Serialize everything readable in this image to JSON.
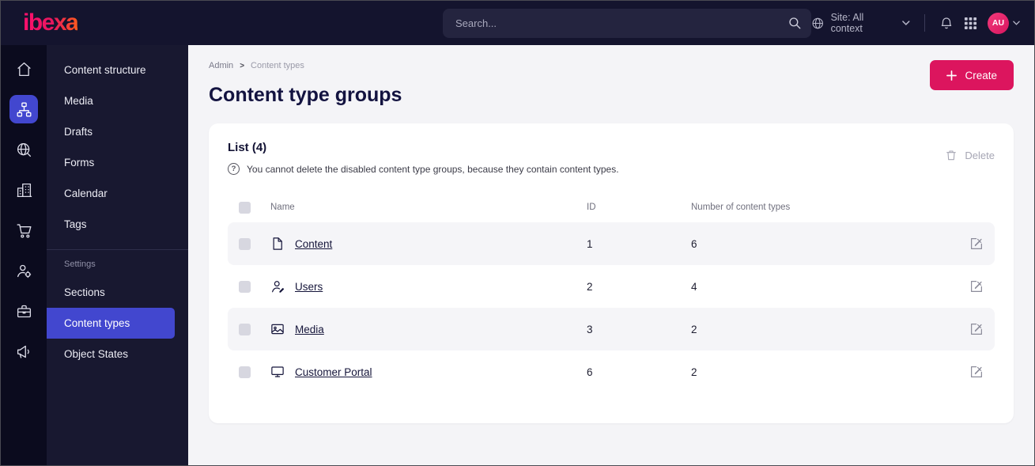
{
  "colors": {
    "accent": "#dc155e",
    "active_blue": "#4247cf"
  },
  "topbar": {
    "logo": "ibexa",
    "search_placeholder": "Search...",
    "site_context_label": "Site: All context",
    "avatar_initials": "AU"
  },
  "icon_rail": {
    "items": [
      "home-icon",
      "content-structure-icon",
      "globe-search-icon",
      "building-icon",
      "cart-icon",
      "admin-icon",
      "toolbox-icon",
      "megaphone-icon"
    ],
    "active_index": 1
  },
  "sidebar": {
    "items": [
      {
        "label": "Content structure"
      },
      {
        "label": "Media"
      },
      {
        "label": "Drafts"
      },
      {
        "label": "Forms"
      },
      {
        "label": "Calendar"
      },
      {
        "label": "Tags"
      }
    ],
    "settings_heading": "Settings",
    "settings_items": [
      {
        "label": "Sections"
      },
      {
        "label": "Content types",
        "active": true
      },
      {
        "label": "Object States"
      }
    ]
  },
  "breadcrumb": {
    "items": [
      "Admin",
      "Content types"
    ],
    "separator": ">"
  },
  "page": {
    "title": "Content type groups",
    "create_label": "Create"
  },
  "card": {
    "list_title": "List (4)",
    "help_glyph": "?",
    "help_text": "You cannot delete the disabled content type groups, because they contain content types.",
    "delete_label": "Delete",
    "table": {
      "headers": {
        "name": "Name",
        "id": "ID",
        "count": "Number of content types"
      },
      "rows": [
        {
          "icon": "file-icon",
          "name": "Content",
          "id": "1",
          "count": "6"
        },
        {
          "icon": "user-icon",
          "name": "Users",
          "id": "2",
          "count": "4"
        },
        {
          "icon": "image-icon",
          "name": "Media",
          "id": "3",
          "count": "2"
        },
        {
          "icon": "monitor-icon",
          "name": "Customer Portal",
          "id": "6",
          "count": "2"
        }
      ]
    }
  }
}
